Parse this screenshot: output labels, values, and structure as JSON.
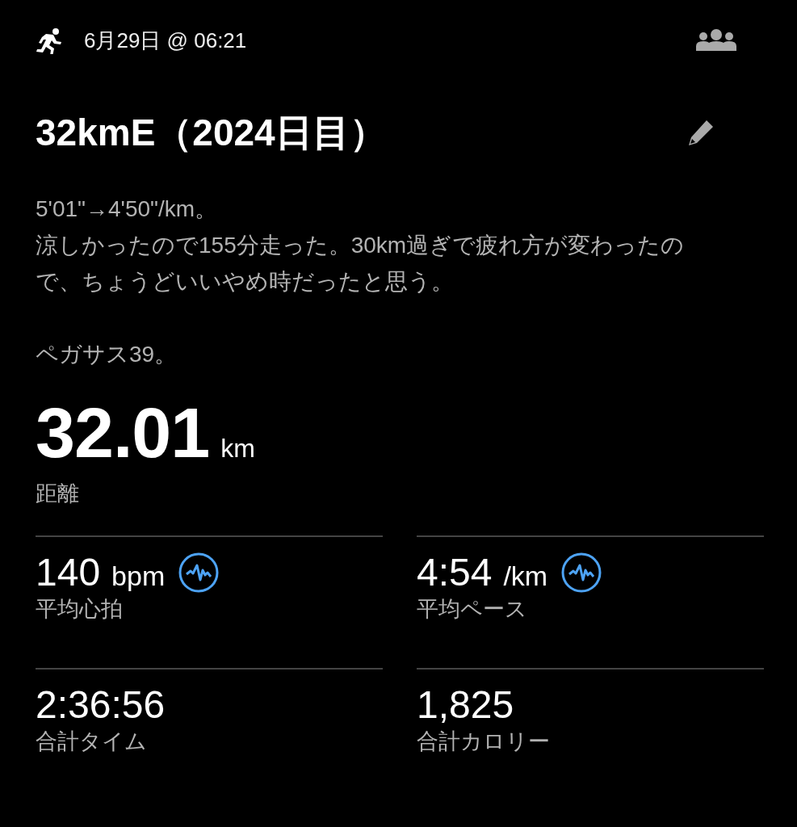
{
  "header": {
    "date": "6月29日 @ 06:21"
  },
  "title": "32kmE（2024日目）",
  "notes": [
    {
      "text": "5'01\"→4'50\"/km。"
    },
    {
      "text": "涼しかったので155分走った。30km過ぎで疲れ方が変わったので、ちょうどいいやめ時だったと思う。"
    },
    {
      "text": "ペガサス39。"
    }
  ],
  "distance": {
    "value": "32.01",
    "unit": "km",
    "label": "距離"
  },
  "stats": [
    {
      "value": "140",
      "unit": "bpm",
      "label": "平均心拍",
      "chart_icon": true
    },
    {
      "value": "4:54",
      "unit": "/km",
      "label": "平均ペース",
      "chart_icon": true
    },
    {
      "value": "2:36:56",
      "label": "合計タイム",
      "chart_icon": false
    },
    {
      "value": "1,825",
      "label": "合計カロリー",
      "chart_icon": false
    }
  ]
}
